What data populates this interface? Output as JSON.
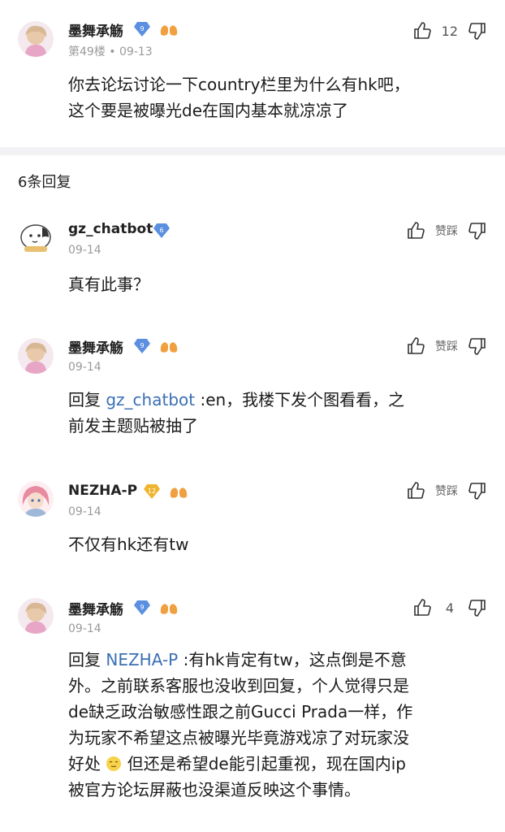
{
  "main_post": {
    "username": "墨舞承觞",
    "level": "9",
    "floor": "第49楼",
    "date": "09-13",
    "like_count": "12",
    "content_line1": "你去论坛讨论一下country栏里为什么有hk吧，",
    "content_line2": "这个要是被曝光de在国内基本就凉凉了"
  },
  "replies_header": "6条回复",
  "replies": [
    {
      "username": "gz_chatbot",
      "level": "6",
      "date": "09-14",
      "action_label": "赞踩",
      "content": "真有此事？"
    },
    {
      "username": "墨舞承觞",
      "level": "9",
      "date": "09-14",
      "action_label": "赞踩",
      "reply_prefix": "回复",
      "mention": "gz_chatbot",
      "content_line1": ":en，我楼下发个图看看，之",
      "content_line2": "前发主题贴被抽了"
    },
    {
      "username": "NEZHA-P",
      "level": "12",
      "date": "09-14",
      "action_label": "赞踩",
      "content": "不仅有hk还有tw"
    },
    {
      "username": "墨舞承觞",
      "level": "9",
      "date": "09-14",
      "like_count": "4",
      "reply_prefix": "回复",
      "mention": "NEZHA-P",
      "content_line1": ":有hk肯定有tw，这点倒是不意",
      "content_line2": "外。之前联系客服也没收到回复，个人觉得只是",
      "content_line3": "de缺乏政治敏感性跟之前Gucci Prada一样，作",
      "content_line4a": "为玩家不希望这点被曝光毕竟游戏凉了对玩家没",
      "content_line5a": "好处",
      "content_line5b": "但还是希望de能引起重视，现在国内ip",
      "content_line6": "被官方论坛屏蔽也没渠道反映这个事情。"
    }
  ],
  "colors": {
    "mention": "#3a6fb5",
    "level_badge_blue": "#5b8fe0",
    "level_badge_gold": "#f0b530",
    "divider": "#f2f2f4"
  },
  "icons": [
    "thumbs-up-icon",
    "thumbs-down-icon",
    "level-diamond-icon",
    "lungs-badge-icon",
    "smiling-emoji-icon"
  ]
}
